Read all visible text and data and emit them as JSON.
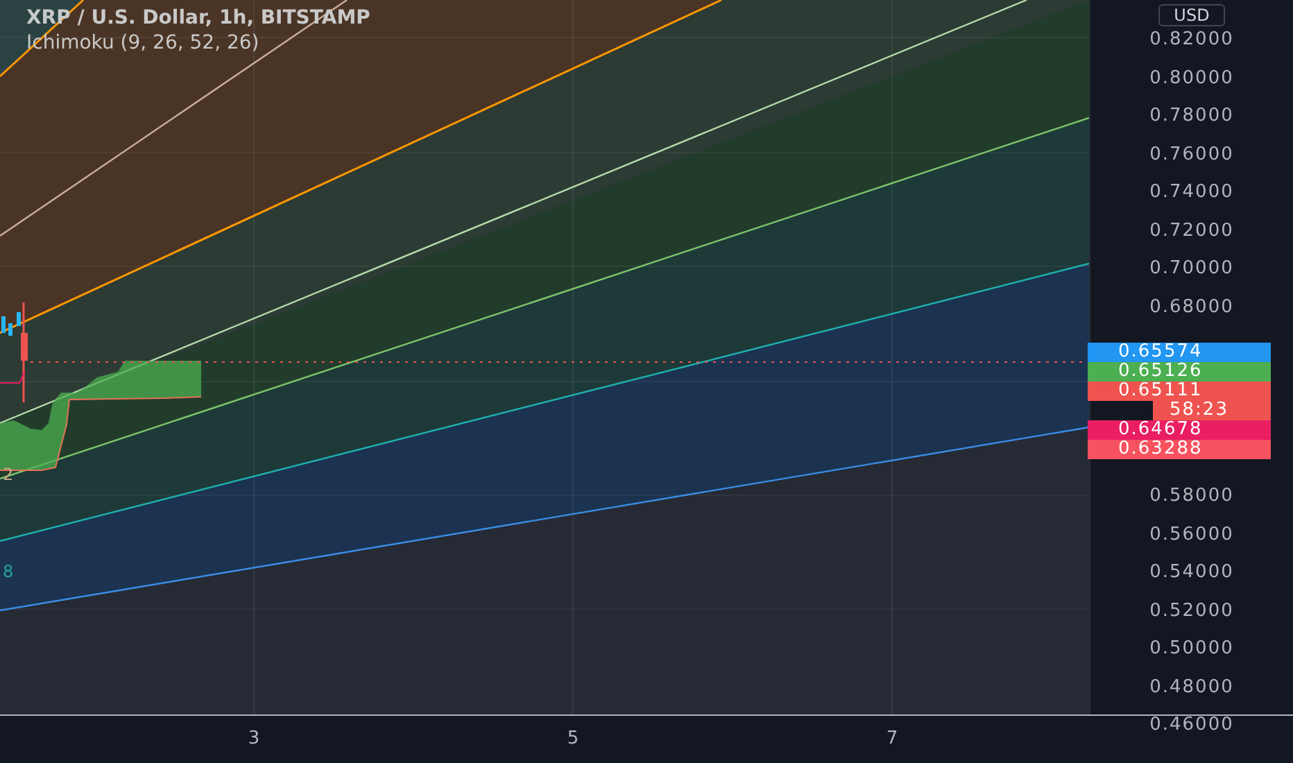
{
  "legend": {
    "title": "XRP / U.S. Dollar, 1h, BITSTAMP",
    "indicator": "Ichimoku (9, 26, 52, 26)"
  },
  "fan_labels": [
    {
      "text": "2",
      "color": "#c9a88a"
    },
    {
      "text": "8",
      "color": "#26a69a"
    }
  ],
  "currency_button": "USD",
  "price_scale_upper": [
    "0.82000",
    "0.80000",
    "0.78000",
    "0.76000",
    "0.74000",
    "0.72000",
    "0.70000",
    "0.68000"
  ],
  "price_scale_lower": [
    "0.58000",
    "0.56000",
    "0.54000",
    "0.52000",
    "0.50000",
    "0.48000",
    "0.46000"
  ],
  "price_tags": [
    {
      "text": "0.65574",
      "color": "#2196f3"
    },
    {
      "text": "0.65126",
      "color": "#4caf50"
    },
    {
      "text": "0.65111",
      "color": "#ef5350"
    },
    {
      "text": "0.64678",
      "color": "#e91e63"
    },
    {
      "text": "0.63288",
      "color": "#f7525f"
    }
  ],
  "countdown": {
    "text": "58:23",
    "color": "#ef5350"
  },
  "time_scale": [
    "3",
    "5",
    "7"
  ]
}
